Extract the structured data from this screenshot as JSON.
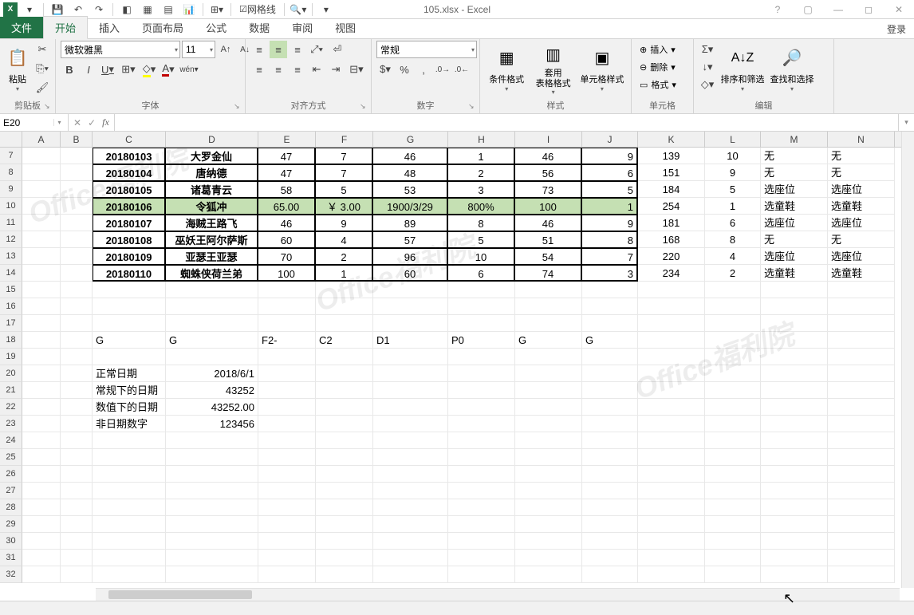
{
  "app": {
    "title": "105.xlsx - Excel",
    "icon": "X"
  },
  "qat": {
    "gridlines_label": "网格线",
    "help_tip": "?"
  },
  "win": {
    "signin": "登录"
  },
  "tabs": {
    "file": "文件",
    "home": "开始",
    "insert": "插入",
    "layout": "页面布局",
    "formulas": "公式",
    "data": "数据",
    "review": "审阅",
    "view": "视图"
  },
  "ribbon": {
    "clipboard": {
      "label": "剪贴板",
      "paste": "粘贴"
    },
    "font": {
      "label": "字体",
      "name": "微软雅黑",
      "size": "11",
      "bold": "B",
      "italic": "I",
      "underline": "U",
      "pinyin": "wén"
    },
    "align": {
      "label": "对齐方式"
    },
    "number": {
      "label": "数字",
      "format": "常规"
    },
    "styles": {
      "label": "样式",
      "cond": "条件格式",
      "table": "套用\n表格格式",
      "cell": "单元格样式"
    },
    "cells": {
      "label": "单元格",
      "insert": "插入",
      "delete": "删除",
      "format": "格式"
    },
    "editing": {
      "label": "编辑",
      "sort": "排序和筛选",
      "find": "查找和选择"
    }
  },
  "fbar": {
    "namebox": "E20",
    "fx": "fx",
    "x": "✕",
    "check": "✓"
  },
  "cols": {
    "A": 48,
    "B": 40,
    "C": 92,
    "D": 116,
    "E": 72,
    "F": 72,
    "G": 94,
    "H": 84,
    "I": 84,
    "J": 70,
    "K": 84,
    "L": 70,
    "M": 84,
    "N": 84
  },
  "table": {
    "rows": [
      {
        "rn": 7,
        "C": "20180103",
        "D": "大罗金仙",
        "E": "47",
        "F": "7",
        "G": "46",
        "H": "1",
        "I": "46",
        "J": "9",
        "K": "139",
        "L": "10",
        "M": "无",
        "N": "无"
      },
      {
        "rn": 8,
        "C": "20180104",
        "D": "唐纳德",
        "E": "47",
        "F": "7",
        "G": "48",
        "H": "2",
        "I": "56",
        "J": "6",
        "K": "151",
        "L": "9",
        "M": "无",
        "N": "无"
      },
      {
        "rn": 9,
        "C": "20180105",
        "D": "诸葛青云",
        "E": "58",
        "F": "5",
        "G": "53",
        "H": "3",
        "I": "73",
        "J": "5",
        "K": "184",
        "L": "5",
        "M": "选座位",
        "N": "选座位"
      },
      {
        "rn": 10,
        "C": "20180106",
        "D": "令狐冲",
        "E": "65.00",
        "F": "￥   3.00",
        "G": "1900/3/29",
        "H": "800%",
        "I": "100",
        "J": "1",
        "K": "254",
        "L": "1",
        "M": "选童鞋",
        "N": "选童鞋",
        "hl": true
      },
      {
        "rn": 11,
        "C": "20180107",
        "D": "海贼王路飞",
        "E": "46",
        "F": "9",
        "G": "89",
        "H": "8",
        "I": "46",
        "J": "9",
        "K": "181",
        "L": "6",
        "M": "选座位",
        "N": "选座位"
      },
      {
        "rn": 12,
        "C": "20180108",
        "D": "巫妖王阿尔萨斯",
        "E": "60",
        "F": "4",
        "G": "57",
        "H": "5",
        "I": "51",
        "J": "8",
        "K": "168",
        "L": "8",
        "M": "无",
        "N": "无"
      },
      {
        "rn": 13,
        "C": "20180109",
        "D": "亚瑟王亚瑟",
        "E": "70",
        "F": "2",
        "G": "96",
        "H": "10",
        "I": "54",
        "J": "7",
        "K": "220",
        "L": "4",
        "M": "选座位",
        "N": "选座位"
      },
      {
        "rn": 14,
        "C": "20180110",
        "D": "蜘蛛侠荷兰弟",
        "E": "100",
        "F": "1",
        "G": "60",
        "H": "6",
        "I": "74",
        "J": "3",
        "K": "234",
        "L": "2",
        "M": "选童鞋",
        "N": "选童鞋",
        "last": true
      }
    ]
  },
  "loose": {
    "r18": {
      "C": "G",
      "D": "G",
      "E": "F2-",
      "F": "C2",
      "G": "D1",
      "H": "P0",
      "I": "G",
      "J": "G"
    },
    "r20": {
      "C": "正常日期",
      "D": "2018/6/1"
    },
    "r21": {
      "C": "常规下的日期",
      "D": "43252"
    },
    "r22": {
      "C": "数值下的日期",
      "D": "43252.00"
    },
    "r23": {
      "C": "非日期数字",
      "D": "123456"
    }
  },
  "watermarks": [
    "Office福利院",
    "Office福利院",
    "Office福利院"
  ]
}
